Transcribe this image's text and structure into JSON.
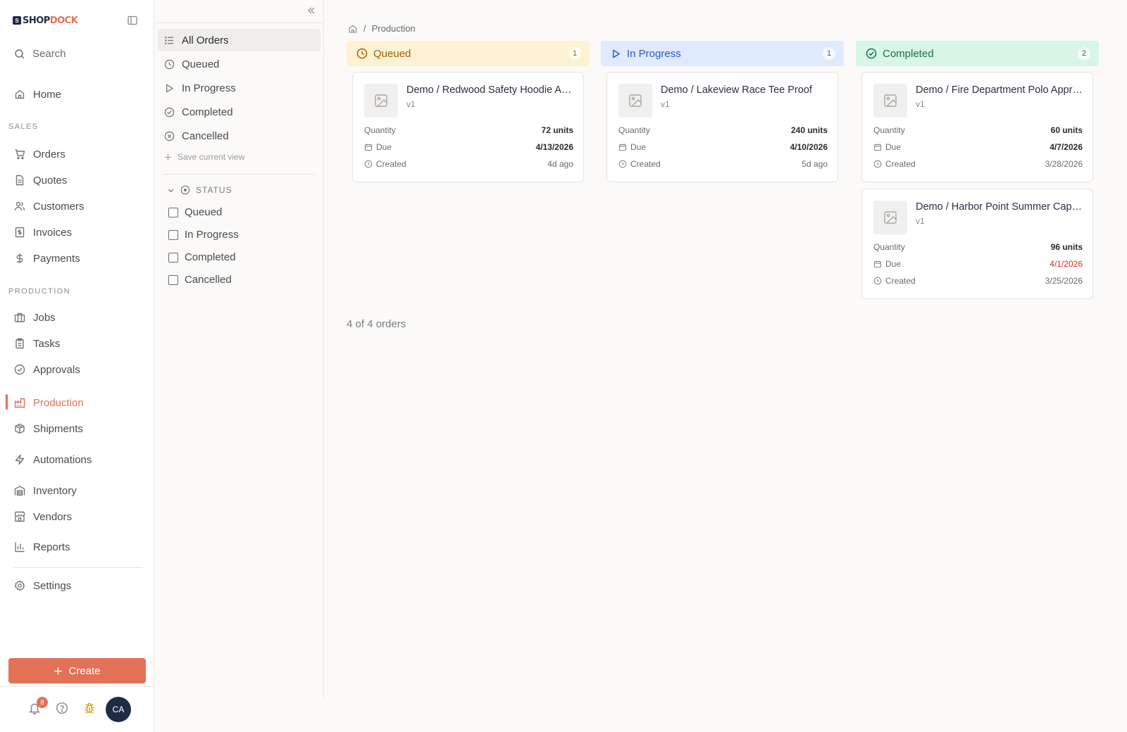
{
  "brand": {
    "shop": "SHOP",
    "dock": "DOCK",
    "mark": "S"
  },
  "sidebar": {
    "search_label": "Search",
    "home": "Home",
    "sales_label": "SALES",
    "sales_items": [
      "Orders",
      "Quotes",
      "Customers",
      "Invoices",
      "Payments"
    ],
    "production_label": "PRODUCTION",
    "production_items": [
      "Jobs",
      "Tasks",
      "Approvals",
      "Production",
      "Shipments"
    ],
    "automations": "Automations",
    "inventory": "Inventory",
    "vendors": "Vendors",
    "reports": "Reports",
    "settings": "Settings",
    "create_label": "Create",
    "notification_count": "8",
    "avatar_initials": "CA",
    "active_item": "Production"
  },
  "views": {
    "items": [
      "All Orders",
      "Queued",
      "In Progress",
      "Completed",
      "Cancelled"
    ],
    "active": "All Orders",
    "save_label": "Save current view",
    "status_heading": "STATUS",
    "status_filters": [
      "Queued",
      "In Progress",
      "Completed",
      "Cancelled"
    ]
  },
  "breadcrumb": {
    "current": "Production"
  },
  "board": {
    "columns": [
      {
        "title": "Queued",
        "count": "1",
        "color": "#a15c05"
      },
      {
        "title": "In Progress",
        "count": "1",
        "color": "#2b56c4"
      },
      {
        "title": "Completed",
        "count": "2",
        "color": "#1f6d4a"
      }
    ],
    "cards": [
      {
        "title": "Demo / Redwood Safety Hoodie Approval",
        "version": "v1",
        "quantity_label": "Quantity",
        "quantity": "72 units",
        "due_label": "Due",
        "due": "4/13/2026",
        "created_label": "Created",
        "created": "4d ago"
      },
      {
        "title": "Demo / Lakeview Race Tee Proof",
        "version": "v1",
        "quantity_label": "Quantity",
        "quantity": "240 units",
        "due_label": "Due",
        "due": "4/10/2026",
        "created_label": "Created",
        "created": "5d ago"
      },
      {
        "title": "Demo / Fire Department Polo Approval",
        "version": "v1",
        "quantity_label": "Quantity",
        "quantity": "60 units",
        "due_label": "Due",
        "due": "4/7/2026",
        "created_label": "Created",
        "created": "3/28/2026"
      },
      {
        "title": "Demo / Harbor Point Summer Cap Proof",
        "version": "v1",
        "quantity_label": "Quantity",
        "quantity": "96 units",
        "due_label": "Due",
        "due": "4/1/2026",
        "created_label": "Created",
        "created": "3/25/2026"
      }
    ],
    "summary": "4 of 4 orders"
  },
  "colors": {
    "accent": "#e27158",
    "overdue": "#d92d20"
  }
}
